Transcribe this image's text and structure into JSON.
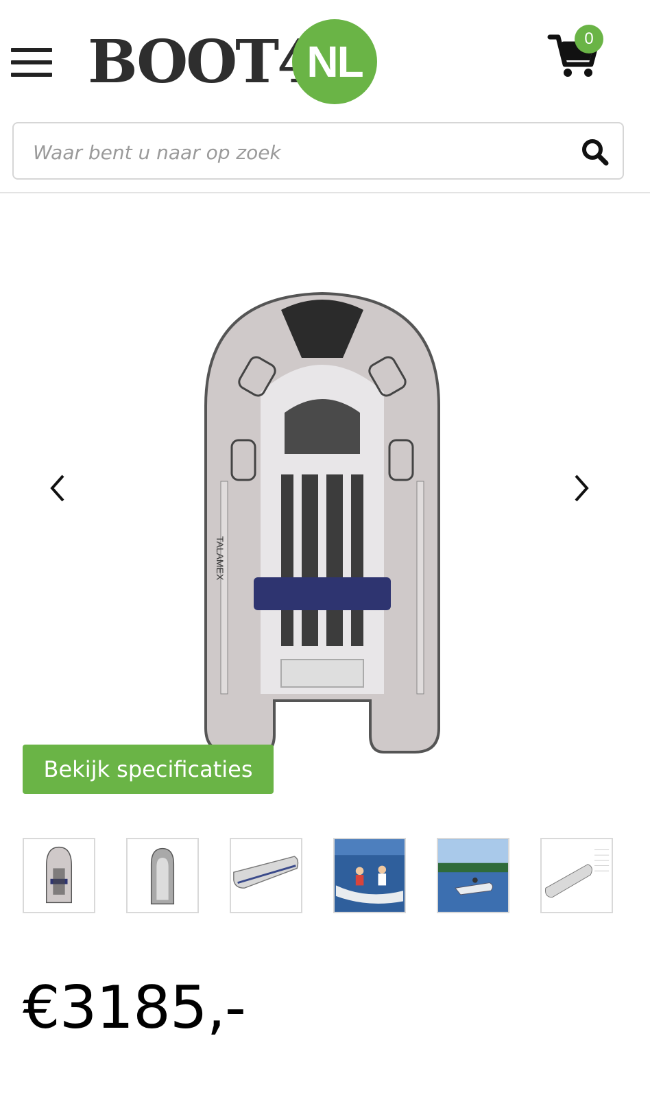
{
  "header": {
    "logo_main": "BOOT4",
    "logo_badge": "NL",
    "cart_count": "0",
    "accent_color": "#6ab446"
  },
  "search": {
    "placeholder": "Waar bent u naar op zoek"
  },
  "gallery": {
    "main_image_icon": "inflatable-boat-top-view",
    "prev_icon": "chevron-left-icon",
    "next_icon": "chevron-right-icon",
    "boat_brand_text": "TALAMEX"
  },
  "product": {
    "spec_button_label": "Bekijk specificaties",
    "price": "€3185,-"
  },
  "thumbnails": [
    {
      "icon": "boat-top-view"
    },
    {
      "icon": "boat-empty-top-view"
    },
    {
      "icon": "boat-side-view"
    },
    {
      "icon": "boat-with-people-on-water"
    },
    {
      "icon": "boat-sailing-on-lake"
    },
    {
      "icon": "boat-technical-drawing"
    }
  ]
}
